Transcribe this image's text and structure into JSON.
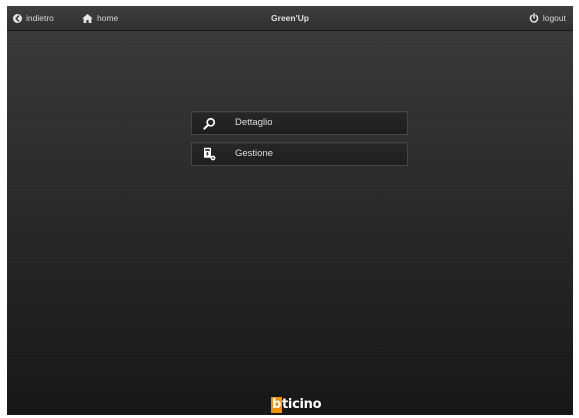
{
  "header": {
    "back_label": "indietro",
    "home_label": "home",
    "title": "Green'Up",
    "logout_label": "logout"
  },
  "menu": {
    "items": [
      {
        "label": "Dettaglio",
        "icon": "search-icon"
      },
      {
        "label": "Gestione",
        "icon": "meter-settings-icon"
      }
    ]
  },
  "footer": {
    "logo_text": "bticino",
    "logo_accent": "#f39200"
  },
  "colors": {
    "background_top": "#3a3b3b",
    "background_bottom": "#151616",
    "text": "#dedede"
  }
}
